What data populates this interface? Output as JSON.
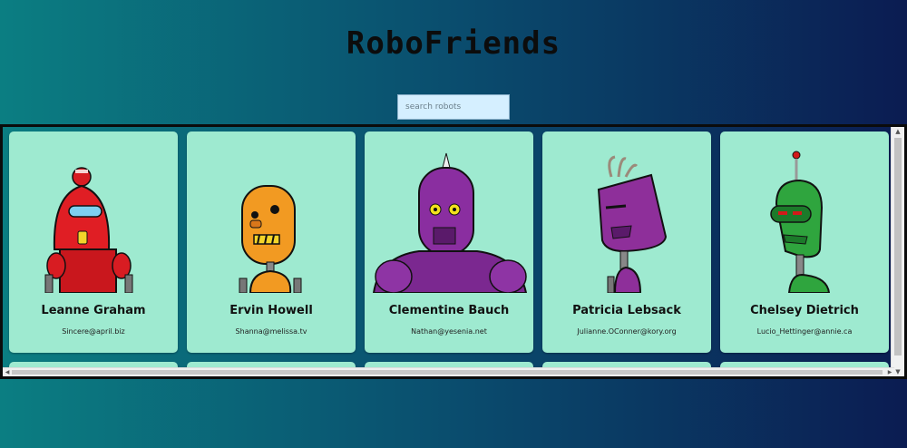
{
  "app": {
    "title": "RoboFriends"
  },
  "search": {
    "placeholder": "search robots",
    "value": ""
  },
  "robots": [
    {
      "name": "Leanne Graham",
      "email": "Sincere@april.biz",
      "color": "#e01e24"
    },
    {
      "name": "Ervin Howell",
      "email": "Shanna@melissa.tv",
      "color": "#f29a22"
    },
    {
      "name": "Clementine Bauch",
      "email": "Nathan@yesenia.net",
      "color": "#8a2ea0"
    },
    {
      "name": "Patricia Lebsack",
      "email": "Julianne.OConner@kory.org",
      "color": "#8e2f9a"
    },
    {
      "name": "Chelsey Dietrich",
      "email": "Lucio_Hettinger@annie.ca",
      "color": "#2fa53e"
    }
  ],
  "colors": {
    "card_bg": "#9eead0",
    "search_bg": "#d5efff"
  }
}
